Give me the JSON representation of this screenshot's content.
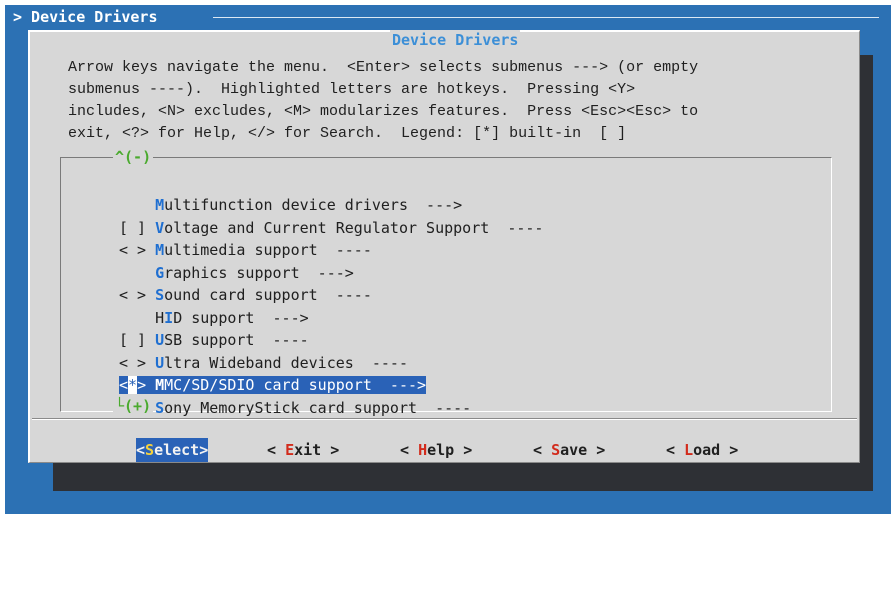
{
  "screen": {
    "title": "> Device Drivers"
  },
  "dialog": {
    "title": "Device Drivers",
    "help_lines": [
      "Arrow keys navigate the menu.  <Enter> selects submenus ---> (or empty",
      "submenus ----).  Highlighted letters are hotkeys.  Pressing <Y>",
      "includes, <N> excludes, <M> modularizes features.  Press <Esc><Esc> to",
      "exit, <?> for Help, </> for Search.  Legend: [*] built-in  [ ]"
    ],
    "scroll_up": "^(-)",
    "scroll_down": "└(+)"
  },
  "menu": {
    "items": [
      {
        "prefix": "    ",
        "hot": "M",
        "rest": "ultifunction device drivers  --->"
      },
      {
        "prefix": "[ ] ",
        "hot": "V",
        "rest": "oltage and Current Regulator Support  ----"
      },
      {
        "prefix": "< > ",
        "hot": "M",
        "rest": "ultimedia support  ----"
      },
      {
        "prefix": "    ",
        "hot": "G",
        "rest": "raphics support  --->"
      },
      {
        "prefix": "< > ",
        "hot": "S",
        "rest": "ound card support  ----"
      },
      {
        "prefix": "    H",
        "hot": "I",
        "rest": "D support  --->"
      },
      {
        "prefix": "[ ] ",
        "hot": "U",
        "rest": "SB support  ----"
      },
      {
        "prefix": "< > ",
        "hot": "U",
        "rest": "ltra Wideband devices  ----"
      },
      {
        "prefix": "<",
        "cursor": "*",
        "prefix2": "> ",
        "hot": "M",
        "rest": "MC/SD/SDIO card support  --->",
        "selected": true
      },
      {
        "prefix": "< > ",
        "hot": "S",
        "rest": "ony MemoryStick card support  ----"
      }
    ]
  },
  "buttons": {
    "select": {
      "left": "<",
      "hot": "S",
      "rest": "elect>"
    },
    "exit": {
      "left": "< ",
      "hot": "E",
      "rest": "xit >"
    },
    "help": {
      "left": "< ",
      "hot": "H",
      "rest": "elp >"
    },
    "save": {
      "left": "< ",
      "hot": "S",
      "rest": "ave >"
    },
    "load": {
      "left": "< ",
      "hot": "L",
      "rest": "oad >"
    }
  },
  "colors": {
    "background_blue": "#2c71b4",
    "dialog_gray": "#d7d7d7",
    "highlight_blue": "#2a62b7",
    "hotkey_blue": "#1f6fd1",
    "button_hotkey_red": "#d22b1c",
    "scroll_green": "#4aaa2e"
  }
}
